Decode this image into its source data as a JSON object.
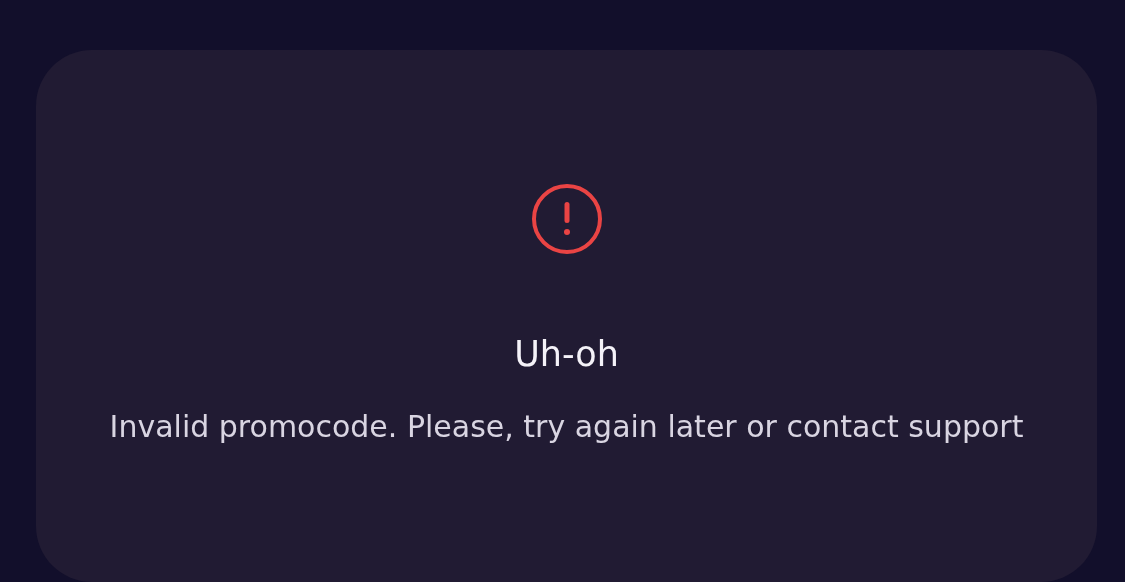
{
  "alert": {
    "title": "Uh-oh",
    "message": "Invalid promocode. Please, try again later or contact support"
  }
}
